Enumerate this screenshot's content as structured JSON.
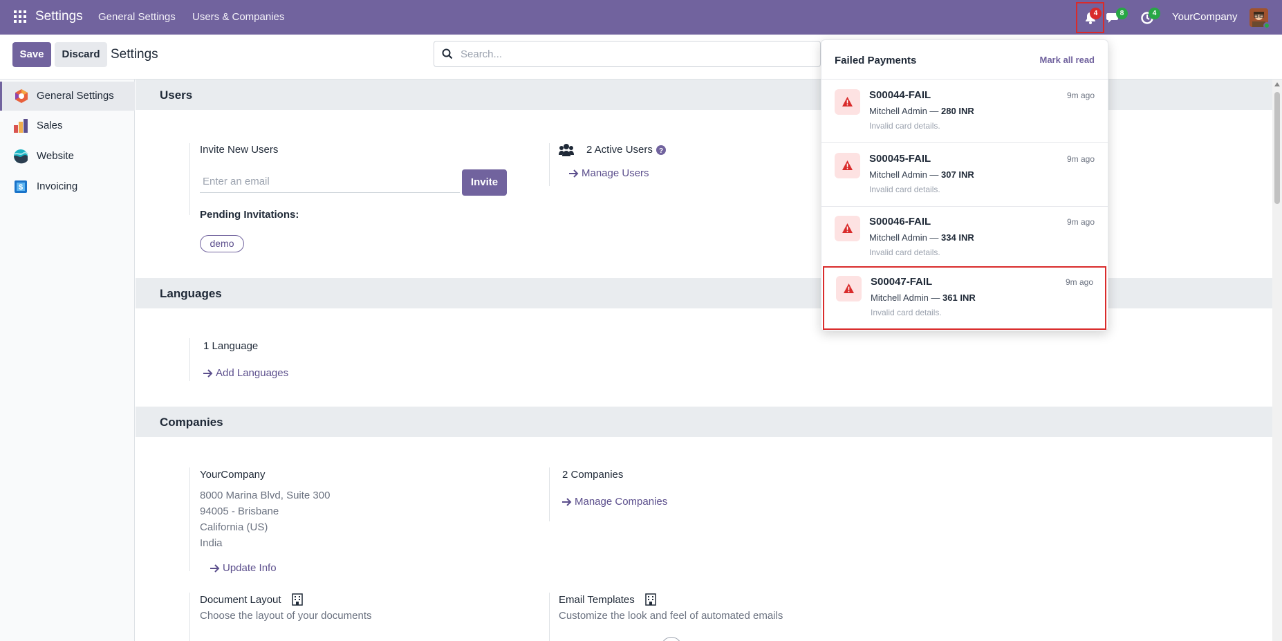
{
  "navbar": {
    "app_title": "Settings",
    "menu": [
      "General Settings",
      "Users & Companies"
    ],
    "notifications_count": "4",
    "messages_count": "8",
    "activities_count": "4",
    "company": "YourCompany"
  },
  "control_panel": {
    "save_label": "Save",
    "discard_label": "Discard",
    "title": "Settings",
    "search_placeholder": "Search..."
  },
  "sidebar": {
    "items": [
      {
        "label": "General Settings",
        "icon": "general-settings-icon",
        "active": true
      },
      {
        "label": "Sales",
        "icon": "sales-icon"
      },
      {
        "label": "Website",
        "icon": "website-icon"
      },
      {
        "label": "Invoicing",
        "icon": "invoicing-icon"
      }
    ]
  },
  "users": {
    "heading": "Users",
    "invite_title": "Invite New Users",
    "email_placeholder": "Enter an email",
    "invite_button": "Invite",
    "pending_label": "Pending Invitations:",
    "pending_tag": "demo",
    "active_users": "2 Active Users",
    "manage_users": "Manage Users"
  },
  "languages": {
    "heading": "Languages",
    "count": "1 Language",
    "add": "Add Languages"
  },
  "companies": {
    "heading": "Companies",
    "name": "YourCompany",
    "address": [
      "8000 Marina Blvd, Suite 300",
      "94005 - Brisbane",
      "California (US)",
      "India"
    ],
    "update_info": "Update Info",
    "count": "2 Companies",
    "manage": "Manage Companies"
  },
  "document_layout": {
    "title": "Document Layout",
    "desc": "Choose the layout of your documents"
  },
  "email_templates": {
    "title": "Email Templates",
    "desc": "Customize the look and feel of automated emails"
  },
  "notifications_panel": {
    "title": "Failed Payments",
    "mark_all": "Mark all read",
    "items": [
      {
        "title": "S00044-FAIL",
        "time": "9m ago",
        "who": "Mitchell Admin — ",
        "amount": "280 INR",
        "desc": "Invalid card details."
      },
      {
        "title": "S00045-FAIL",
        "time": "9m ago",
        "who": "Mitchell Admin — ",
        "amount": "307 INR",
        "desc": "Invalid card details."
      },
      {
        "title": "S00046-FAIL",
        "time": "9m ago",
        "who": "Mitchell Admin — ",
        "amount": "334 INR",
        "desc": "Invalid card details."
      },
      {
        "title": "S00047-FAIL",
        "time": "9m ago",
        "who": "Mitchell Admin — ",
        "amount": "361 INR",
        "desc": "Invalid card details."
      }
    ]
  },
  "colors": {
    "brand": "#71639e",
    "link": "#5b4e8c",
    "alert": "#d92b2b",
    "badge_green": "#28a745"
  }
}
